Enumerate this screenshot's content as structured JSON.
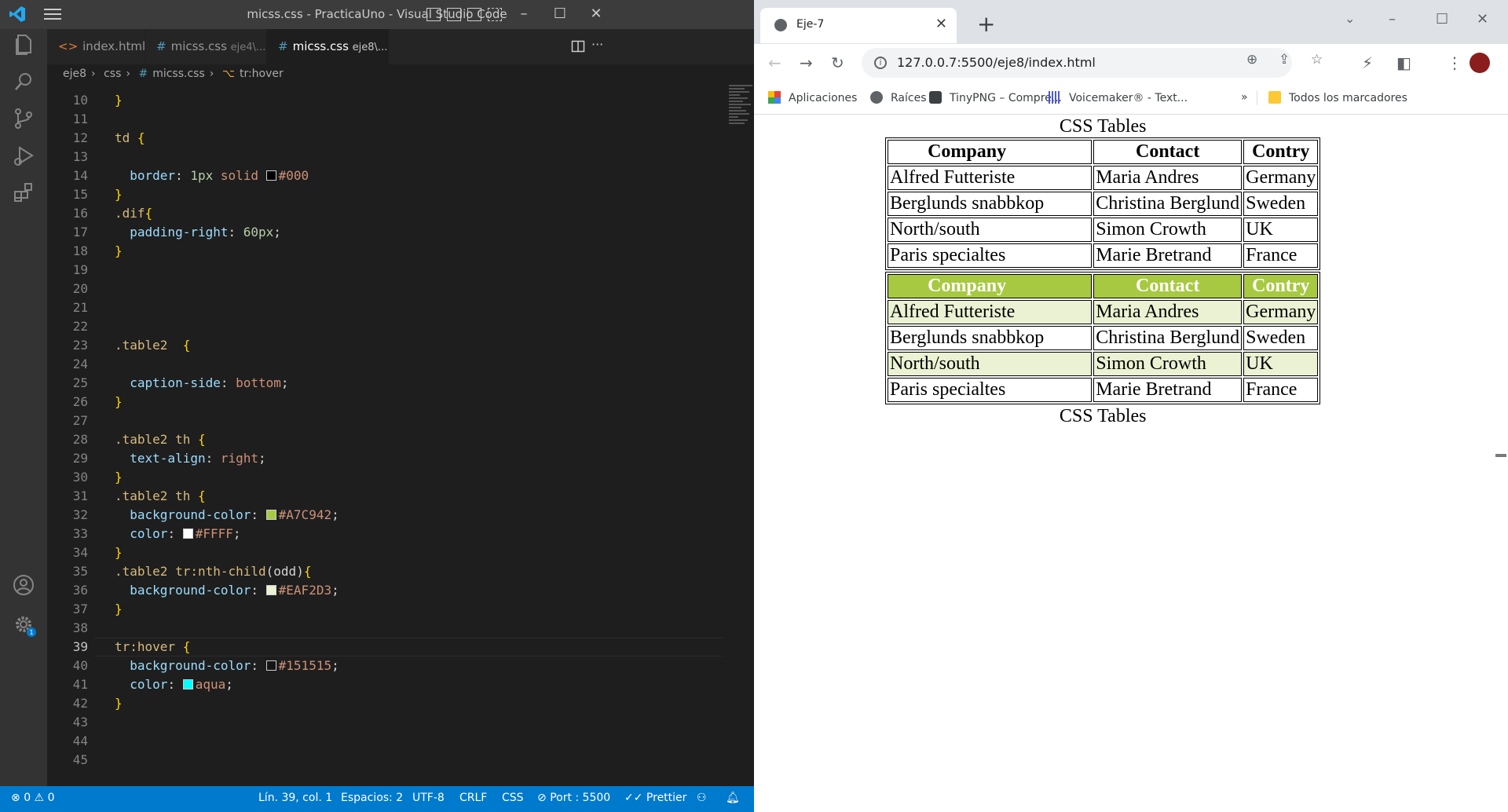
{
  "vscode": {
    "title": "micss.css - PracticaUno - Visual Studio Code",
    "tabs": [
      {
        "name": "index.html",
        "desc": ""
      },
      {
        "name": "micss.css",
        "desc": "eje4\\..."
      },
      {
        "name": "micss.css",
        "desc": "eje8\\..."
      }
    ],
    "close_glyph": "✕",
    "breadcrumb": [
      "eje8",
      "css",
      "micss.css",
      "tr:hover"
    ],
    "status": {
      "errors": "0",
      "warnings": "0",
      "position": "Lín. 39, col. 1",
      "spaces": "Espacios: 2",
      "encoding": "UTF-8",
      "eol": "CRLF",
      "language": "CSS",
      "port": "Port : 5500",
      "formatter": "Prettier",
      "notif_count": "1"
    },
    "lines": [
      {
        "n": "10",
        "t": [
          [
            "}",
            "c-br"
          ]
        ]
      },
      {
        "n": "11",
        "t": []
      },
      {
        "n": "12",
        "t": [
          [
            "td ",
            "c-sel"
          ],
          [
            "{",
            "c-br"
          ]
        ]
      },
      {
        "n": "13",
        "t": []
      },
      {
        "n": "14",
        "t": [
          [
            "  border",
            "c-prop"
          ],
          [
            ": ",
            "c-punc"
          ],
          [
            "1px ",
            "c-num"
          ],
          [
            "solid ",
            "c-val"
          ],
          [
            "#000000|#000",
            "sw"
          ]
        ]
      },
      {
        "n": "15",
        "t": [
          [
            "}",
            "c-br"
          ]
        ]
      },
      {
        "n": "16",
        "t": [
          [
            ".dif",
            "c-sel"
          ],
          [
            "{",
            "c-br"
          ]
        ]
      },
      {
        "n": "17",
        "t": [
          [
            "  padding-right",
            "c-prop"
          ],
          [
            ": ",
            "c-punc"
          ],
          [
            "60px",
            "c-num"
          ],
          [
            ";",
            "c-punc"
          ]
        ]
      },
      {
        "n": "18",
        "t": [
          [
            "}",
            "c-br"
          ]
        ]
      },
      {
        "n": "19",
        "t": []
      },
      {
        "n": "20",
        "t": []
      },
      {
        "n": "21",
        "t": []
      },
      {
        "n": "22",
        "t": []
      },
      {
        "n": "23",
        "t": [
          [
            ".table2  ",
            "c-sel"
          ],
          [
            "{",
            "c-br"
          ]
        ]
      },
      {
        "n": "24",
        "t": []
      },
      {
        "n": "25",
        "t": [
          [
            "  caption-side",
            "c-prop"
          ],
          [
            ": ",
            "c-punc"
          ],
          [
            "bottom",
            "c-val"
          ],
          [
            ";",
            "c-punc"
          ]
        ]
      },
      {
        "n": "26",
        "t": [
          [
            "}",
            "c-br"
          ]
        ]
      },
      {
        "n": "27",
        "t": []
      },
      {
        "n": "28",
        "t": [
          [
            ".table2 th ",
            "c-sel"
          ],
          [
            "{",
            "c-br"
          ]
        ]
      },
      {
        "n": "29",
        "t": [
          [
            "  text-align",
            "c-prop"
          ],
          [
            ": ",
            "c-punc"
          ],
          [
            "right",
            "c-val"
          ],
          [
            ";",
            "c-punc"
          ]
        ]
      },
      {
        "n": "30",
        "t": [
          [
            "}",
            "c-br"
          ]
        ]
      },
      {
        "n": "31",
        "t": [
          [
            ".table2 th ",
            "c-sel"
          ],
          [
            "{",
            "c-br"
          ]
        ]
      },
      {
        "n": "32",
        "t": [
          [
            "  background-color",
            "c-prop"
          ],
          [
            ": ",
            "c-punc"
          ],
          [
            "#A7C942|#A7C942",
            "sw"
          ],
          [
            ";",
            "c-punc"
          ]
        ]
      },
      {
        "n": "33",
        "t": [
          [
            "  color",
            "c-prop"
          ],
          [
            ": ",
            "c-punc"
          ],
          [
            "#FFFFFF|#FFFF",
            "sw"
          ],
          [
            ";",
            "c-punc"
          ]
        ]
      },
      {
        "n": "34",
        "t": [
          [
            "}",
            "c-br"
          ]
        ]
      },
      {
        "n": "35",
        "t": [
          [
            ".table2 tr:nth-child",
            "c-sel"
          ],
          [
            "(odd)",
            "c-punc"
          ],
          [
            "{",
            "c-br"
          ]
        ]
      },
      {
        "n": "36",
        "t": [
          [
            "  background-color",
            "c-prop"
          ],
          [
            ": ",
            "c-punc"
          ],
          [
            "#EAF2D3|#EAF2D3",
            "sw"
          ],
          [
            ";",
            "c-punc"
          ]
        ]
      },
      {
        "n": "37",
        "t": [
          [
            "}",
            "c-br"
          ]
        ]
      },
      {
        "n": "38",
        "t": []
      },
      {
        "n": "39",
        "t": [
          [
            "tr:hover ",
            "c-sel"
          ],
          [
            "{",
            "c-br"
          ]
        ]
      },
      {
        "n": "40",
        "t": [
          [
            "  background-color",
            "c-prop"
          ],
          [
            ": ",
            "c-punc"
          ],
          [
            "#151515|#151515",
            "sw"
          ],
          [
            ";",
            "c-punc"
          ]
        ]
      },
      {
        "n": "41",
        "t": [
          [
            "  color",
            "c-prop"
          ],
          [
            ": ",
            "c-punc"
          ],
          [
            "#00FFFF|aqua",
            "sw"
          ],
          [
            ";",
            "c-punc"
          ]
        ]
      },
      {
        "n": "42",
        "t": [
          [
            "}",
            "c-br"
          ]
        ]
      },
      {
        "n": "43",
        "t": []
      },
      {
        "n": "44",
        "t": []
      },
      {
        "n": "45",
        "t": []
      }
    ],
    "current_line": "39",
    "colors": {
      "accent": "#007acc",
      "editor_bg": "#1e1e1e"
    }
  },
  "browser": {
    "tab_title": "Eje-7",
    "url": "127.0.0.7:5500/eje8/index.html",
    "bookmarks": [
      {
        "label": "Aplicaciones",
        "icon": "apps-grid-icon"
      },
      {
        "label": "Raíces",
        "icon": "globe-icon"
      },
      {
        "label": "TinyPNG – Compre...",
        "icon": "panda-icon"
      },
      {
        "label": "Voicemaker® - Text...",
        "icon": "audio-bars-icon"
      }
    ],
    "bookmarks_more": "»",
    "all_bookmarks": "Todos los marcadores"
  },
  "page": {
    "caption": "CSS Tables",
    "headers": [
      "Company",
      "Contact",
      "Contry"
    ],
    "rows": [
      [
        "Alfred Futteriste",
        "Maria Andres",
        "Germany"
      ],
      [
        "Berglunds snabbkop",
        "Christina Berglund",
        "Sweden"
      ],
      [
        "North/south",
        "Simon Crowth",
        "UK"
      ],
      [
        "Paris specialtes",
        "Marie Bretrand",
        "France"
      ]
    ],
    "colors": {
      "header_bg": "#A7C942",
      "header_text": "#FFFFFF",
      "odd_row_bg": "#EAF2D3"
    }
  }
}
